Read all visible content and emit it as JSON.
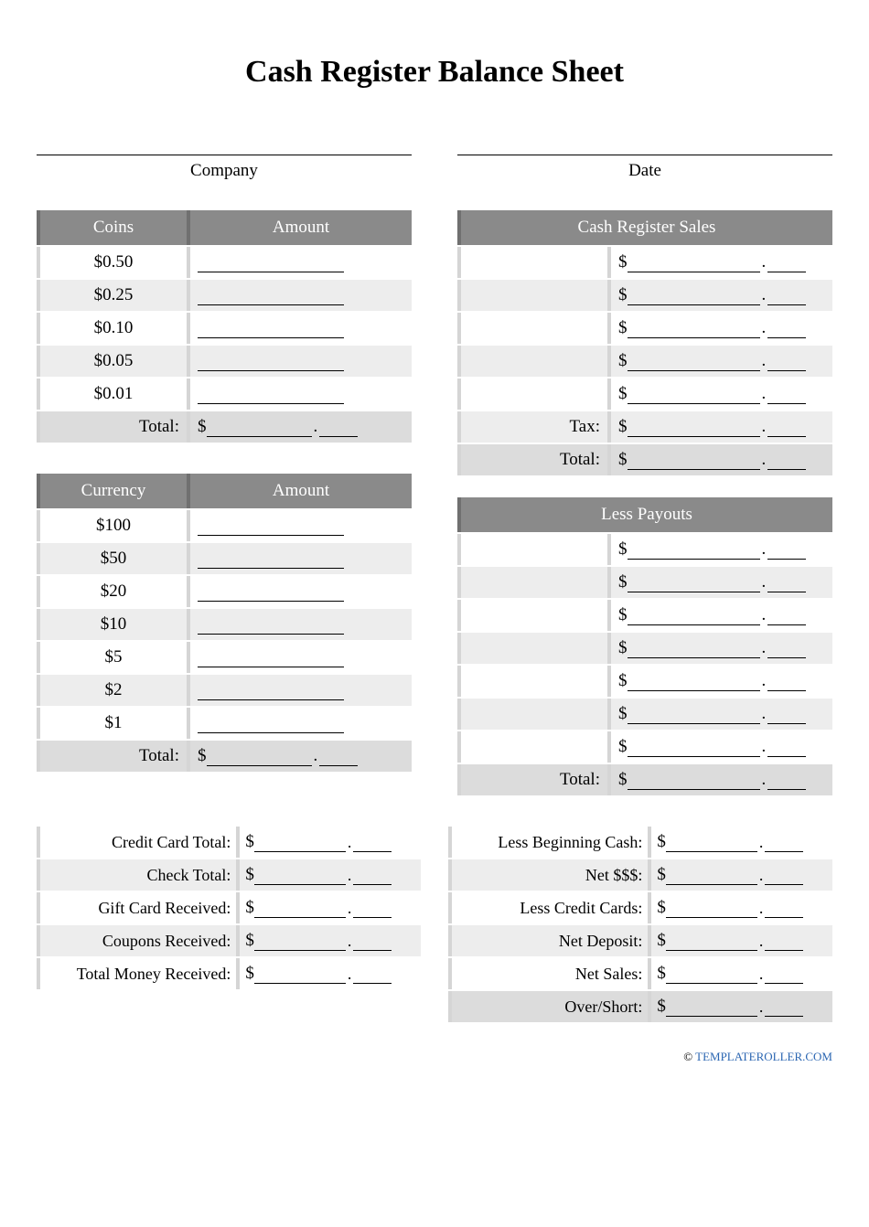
{
  "title": "Cash Register Balance Sheet",
  "header": {
    "company_label": "Company",
    "date_label": "Date"
  },
  "coins": {
    "header_left": "Coins",
    "header_right": "Amount",
    "rows": [
      "$0.50",
      "$0.25",
      "$0.10",
      "$0.05",
      "$0.01"
    ],
    "total_label": "Total:"
  },
  "currency": {
    "header_left": "Currency",
    "header_right": "Amount",
    "rows": [
      "$100",
      "$50",
      "$20",
      "$10",
      "$5",
      "$2",
      "$1"
    ],
    "total_label": "Total:"
  },
  "sales": {
    "header": "Cash Register Sales",
    "blank_rows": 5,
    "tax_label": "Tax:",
    "total_label": "Total:"
  },
  "payouts": {
    "header": "Less Payouts",
    "blank_rows": 7,
    "total_label": "Total:"
  },
  "left_bottom": {
    "r1": "Credit Card Total:",
    "r2": "Check Total:",
    "r3": "Gift Card Received:",
    "r4": "Coupons Received:",
    "r5": "Total Money Received:"
  },
  "right_bottom": {
    "r1": "Less Beginning Cash:",
    "r2": "Net $$$:",
    "r3": "Less Credit Cards:",
    "r4": "Net Deposit:",
    "r5": "Net Sales:",
    "r6": "Over/Short:"
  },
  "footer": {
    "copyright": "©",
    "link": "TEMPLATEROLLER.COM"
  }
}
